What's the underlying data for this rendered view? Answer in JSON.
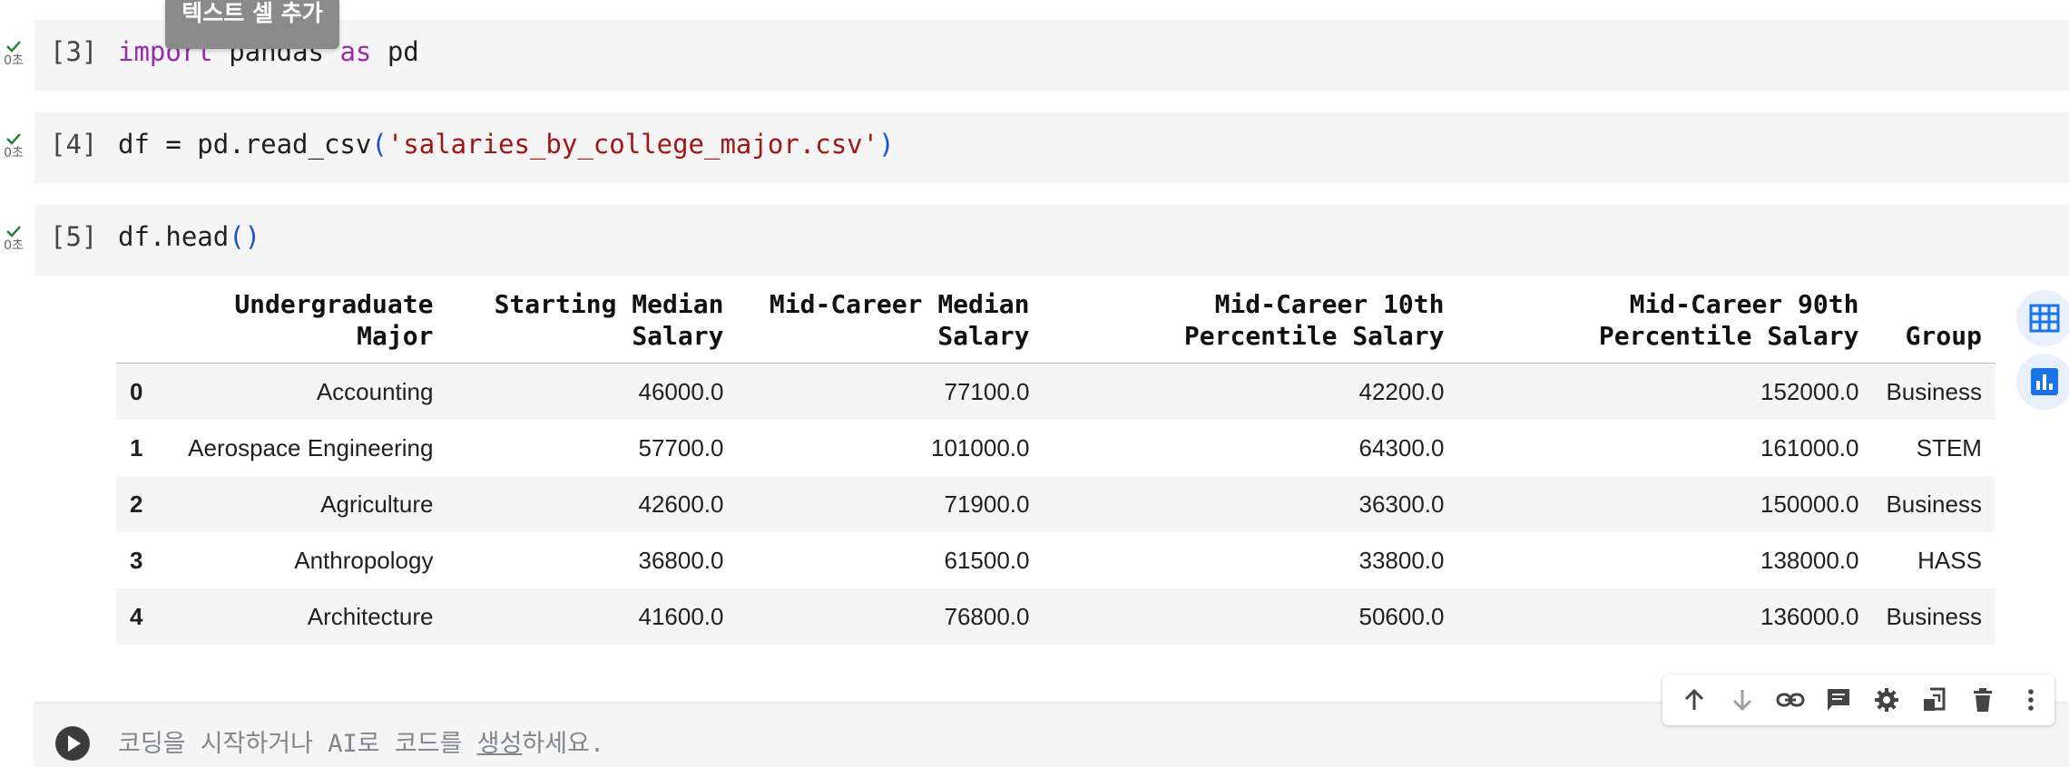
{
  "tooltip": "텍스트 셀 추가",
  "cells": [
    {
      "prompt": "[3]",
      "status_time": "0초",
      "code": {
        "kw1": "import",
        "mid": " pandas ",
        "kw2": "as",
        "end": " pd"
      }
    },
    {
      "prompt": "[4]",
      "status_time": "0초",
      "code": {
        "pre": "df = pd.read_csv",
        "open": "(",
        "str": "'salaries_by_college_major.csv'",
        "close": ")"
      }
    },
    {
      "prompt": "[5]",
      "status_time": "0초",
      "code": {
        "pre": "df.head",
        "parens": "()"
      }
    }
  ],
  "dataframe": {
    "columns": [
      [
        "Undergraduate",
        "Major"
      ],
      [
        "Starting Median",
        "Salary"
      ],
      [
        "Mid-Career Median",
        "Salary"
      ],
      [
        "Mid-Career 10th",
        "Percentile Salary"
      ],
      [
        "Mid-Career 90th",
        "Percentile Salary"
      ],
      [
        "Group"
      ]
    ],
    "rows": [
      {
        "index": "0",
        "major": "Accounting",
        "start": "46000.0",
        "mid": "77100.0",
        "p10": "42200.0",
        "p90": "152000.0",
        "group": "Business"
      },
      {
        "index": "1",
        "major": "Aerospace Engineering",
        "start": "57700.0",
        "mid": "101000.0",
        "p10": "64300.0",
        "p90": "161000.0",
        "group": "STEM"
      },
      {
        "index": "2",
        "major": "Agriculture",
        "start": "42600.0",
        "mid": "71900.0",
        "p10": "36300.0",
        "p90": "150000.0",
        "group": "Business"
      },
      {
        "index": "3",
        "major": "Anthropology",
        "start": "36800.0",
        "mid": "61500.0",
        "p10": "33800.0",
        "p90": "138000.0",
        "group": "HASS"
      },
      {
        "index": "4",
        "major": "Architecture",
        "start": "41600.0",
        "mid": "76800.0",
        "p10": "50600.0",
        "p90": "136000.0",
        "group": "Business"
      }
    ]
  },
  "side_buttons": [
    "table-icon",
    "chart-icon"
  ],
  "toolbar": [
    "arrow-up-icon",
    "arrow-down-icon",
    "link-icon",
    "comment-icon",
    "gear-icon",
    "mirror-cell-icon",
    "trash-icon",
    "more-vert-icon"
  ],
  "new_cell": {
    "placeholder_pre": "코딩을 시작하거나 AI로 코드를 ",
    "placeholder_link": "생성",
    "placeholder_post": "하세요."
  },
  "colors": {
    "keyword": "#9c27b0",
    "string": "#a31515",
    "paren": "#1a4fd6",
    "check": "#188038",
    "accent": "#1a73e8"
  }
}
